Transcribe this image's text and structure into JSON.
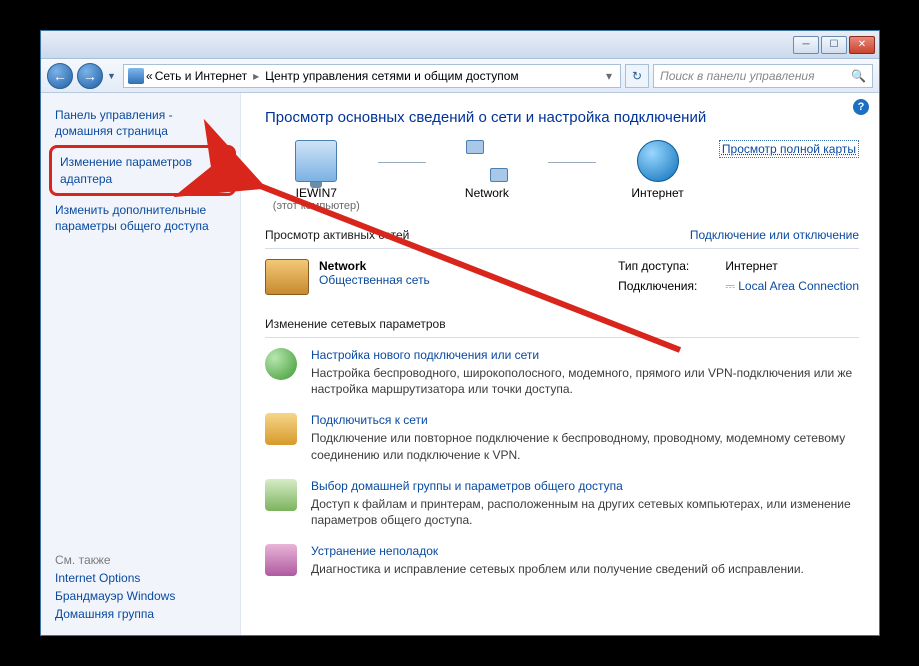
{
  "titlebar": {
    "min_tooltip": "Свернуть",
    "max_tooltip": "Развернуть",
    "close_tooltip": "Закрыть"
  },
  "nav": {
    "back_tooltip": "Назад",
    "fwd_tooltip": "Вперёд",
    "bc_prefix": "«",
    "bc_level1": "Сеть и Интернет",
    "bc_level2": "Центр управления сетями и общим доступом",
    "refresh_tooltip": "Обновить",
    "search_placeholder": "Поиск в панели управления"
  },
  "sidebar": {
    "home": "Панель управления - домашняя страница",
    "adapter": "Изменение параметров адаптера",
    "advanced": "Изменить дополнительные параметры общего доступа",
    "seealso_label": "См. также",
    "seealso": {
      "internet_options": "Internet Options",
      "firewall": "Брандмауэр Windows",
      "homegroup": "Домашняя группа"
    }
  },
  "main": {
    "heading": "Просмотр основных сведений о сети и настройка подключений",
    "nodes": {
      "computer_name": "IEWIN7",
      "computer_sub": "(этот компьютер)",
      "network_name": "Network",
      "internet_name": "Интернет"
    },
    "full_map": "Просмотр полной карты",
    "active_title": "Просмотр активных сетей",
    "connect_toggle": "Подключение или отключение",
    "active": {
      "name": "Network",
      "type": "Общественная сеть",
      "access_label": "Тип доступа:",
      "access_value": "Интернет",
      "conn_label": "Подключения:",
      "conn_value": "Local Area Connection"
    },
    "change_title": "Изменение сетевых параметров",
    "settings": [
      {
        "title": "Настройка нового подключения или сети",
        "desc": "Настройка беспроводного, широкополосного, модемного, прямого или VPN-подключения или же настройка маршрутизатора или точки доступа."
      },
      {
        "title": "Подключиться к сети",
        "desc": "Подключение или повторное подключение к беспроводному, проводному, модемному сетевому соединению или подключение к VPN."
      },
      {
        "title": "Выбор домашней группы и параметров общего доступа",
        "desc": "Доступ к файлам и принтерам, расположенным на других сетевых компьютерах, или изменение параметров общего доступа."
      },
      {
        "title": "Устранение неполадок",
        "desc": "Диагностика и исправление сетевых проблем или получение сведений об исправлении."
      }
    ]
  },
  "help_tooltip": "Справка"
}
